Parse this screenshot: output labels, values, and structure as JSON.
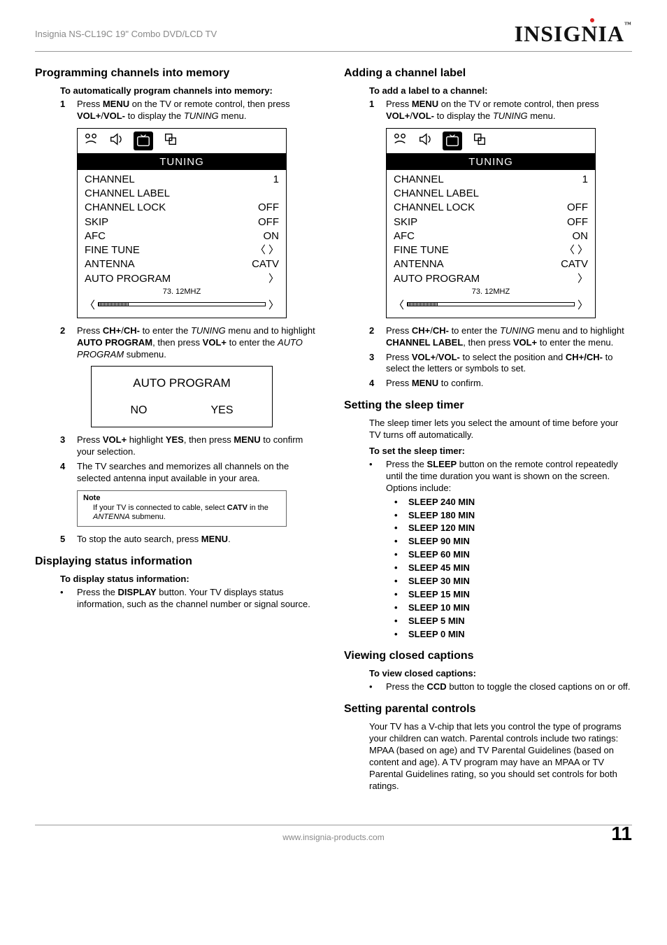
{
  "header": {
    "product": "Insignia NS-CL19C 19\" Combo DVD/LCD TV",
    "brand": "INSIGNIA"
  },
  "left": {
    "sec1_h": "Programming channels into memory",
    "sec1_sub": "To automatically program channels into memory:",
    "sec1_step1": {
      "num": "1",
      "text_a": "Press ",
      "b1": "MENU",
      "text_b": " on the TV or remote control, then press ",
      "b2": "VOL+",
      "text_c": "/",
      "b3": "VOL-",
      "text_d": "  to display the ",
      "i1": "TUNING",
      "text_e": " menu."
    },
    "osd1": {
      "title": "TUNING",
      "rows": [
        {
          "l": "CHANNEL",
          "r": "1"
        },
        {
          "l": "CHANNEL LABEL",
          "r": ""
        },
        {
          "l": "CHANNEL LOCK",
          "r": "OFF"
        },
        {
          "l": "SKIP",
          "r": "OFF"
        },
        {
          "l": "AFC",
          "r": "ON"
        },
        {
          "l": "FINE TUNE",
          "r": "〈 〉"
        },
        {
          "l": "ANTENNA",
          "r": "CATV"
        },
        {
          "l": "AUTO PROGRAM",
          "r": "〉"
        }
      ],
      "freq": "73.  12MHZ"
    },
    "sec1_step2": {
      "num": "2",
      "text_a": "Press ",
      "b1": "CH+",
      "text_b": "/",
      "b2": "CH-",
      "text_c": " to enter the ",
      "i1": "TUNING",
      "text_d": " menu and to highlight ",
      "b3": "AUTO PROGRAM",
      "text_e": ", then press ",
      "b4": "VOL+",
      "text_f": " to enter the ",
      "i2": "AUTO PROGRAM",
      "text_g": " submenu."
    },
    "autoprog": {
      "title": "AUTO PROGRAM",
      "no": "NO",
      "yes": "YES"
    },
    "sec1_step3": {
      "num": "3",
      "text_a": "Press ",
      "b1": "VOL+",
      "text_b": " highlight ",
      "b2": "YES",
      "text_c": ", then press ",
      "b3": "MENU",
      "text_d": " to confirm your selection."
    },
    "sec1_step4": {
      "num": "4",
      "text": "The TV searches and memorizes all channels on the selected antenna input available in your area."
    },
    "note": {
      "title": "Note",
      "text_a": "If your TV is connected to cable, select ",
      "b1": "CATV",
      "text_b": " in the ",
      "i1": "ANTENNA",
      "text_c": " submenu."
    },
    "sec1_step5": {
      "num": "5",
      "text_a": "To stop the auto search, press ",
      "b1": "MENU",
      "text_b": "."
    },
    "sec2_h": "Displaying status information",
    "sec2_sub": "To display status information:",
    "sec2_bullet": {
      "text_a": "Press the ",
      "b1": "DISPLAY",
      "text_b": " button. Your TV displays status information, such as the channel number or signal source."
    }
  },
  "right": {
    "sec3_h": "Adding a channel label",
    "sec3_sub": "To add a label to a channel:",
    "sec3_step1": {
      "num": "1",
      "text_a": "Press ",
      "b1": "MENU",
      "text_b": " on the TV or remote control, then press ",
      "b2": "VOL+",
      "text_c": "/",
      "b3": "VOL-",
      "text_d": "  to display the ",
      "i1": "TUNING",
      "text_e": " menu."
    },
    "osd2": {
      "title": "TUNING",
      "rows": [
        {
          "l": "CHANNEL",
          "r": "1"
        },
        {
          "l": "CHANNEL LABEL",
          "r": ""
        },
        {
          "l": "CHANNEL LOCK",
          "r": "OFF"
        },
        {
          "l": "SKIP",
          "r": "OFF"
        },
        {
          "l": "AFC",
          "r": "ON"
        },
        {
          "l": "FINE TUNE",
          "r": "〈 〉"
        },
        {
          "l": "ANTENNA",
          "r": "CATV"
        },
        {
          "l": "AUTO PROGRAM",
          "r": "〉"
        }
      ],
      "freq": "73.  12MHZ"
    },
    "sec3_step2": {
      "num": "2",
      "text_a": "Press ",
      "b1": "CH+",
      "text_b": "/",
      "b2": "CH-",
      "text_c": " to enter the ",
      "i1": "TUNING",
      "text_d": " menu and to highlight ",
      "b3": "CHANNEL LABEL",
      "text_e": ", then press ",
      "b4": "VOL+",
      "text_f": " to enter the menu."
    },
    "sec3_step3": {
      "num": "3",
      "text_a": "Press ",
      "b1": "VOL+",
      "text_b": "/",
      "b2": "VOL-",
      "text_c": " to select the position and ",
      "b3": "CH+/CH-",
      "text_d": " to select the letters or symbols to set."
    },
    "sec3_step4": {
      "num": "4",
      "text_a": "Press ",
      "b1": "MENU",
      "text_b": " to confirm."
    },
    "sec4_h": "Setting the sleep timer",
    "sec4_para": "The sleep timer lets you select the amount of time before your TV turns off automatically.",
    "sec4_sub": "To set the sleep timer:",
    "sec4_bullet": {
      "text_a": "Press the ",
      "b1": "SLEEP",
      "text_b": " button on the remote control repeatedly until the time duration you want is shown on the screen. Options include:"
    },
    "sleep_opts": [
      "SLEEP 240 MIN",
      "SLEEP 180 MIN",
      "SLEEP 120 MIN",
      "SLEEP 90 MIN",
      "SLEEP 60 MIN",
      "SLEEP 45 MIN",
      "SLEEP 30 MIN",
      "SLEEP 15 MIN",
      "SLEEP 10 MIN",
      "SLEEP 5 MIN",
      "SLEEP 0 MIN"
    ],
    "sec5_h": "Viewing closed captions",
    "sec5_sub": "To view closed captions:",
    "sec5_bullet": {
      "text_a": "Press the ",
      "b1": "CCD",
      "text_b": " button to toggle the closed captions on or off."
    },
    "sec6_h": "Setting parental controls",
    "sec6_para": "Your TV has a V-chip that lets you control the type of programs your children can watch. Parental controls include two ratings: MPAA (based on age) and TV Parental Guidelines (based on content and age). A TV program may have an MPAA or TV Parental Guidelines rating, so you should set controls for both ratings."
  },
  "footer": {
    "url": "www.insignia-products.com",
    "page": "11"
  }
}
